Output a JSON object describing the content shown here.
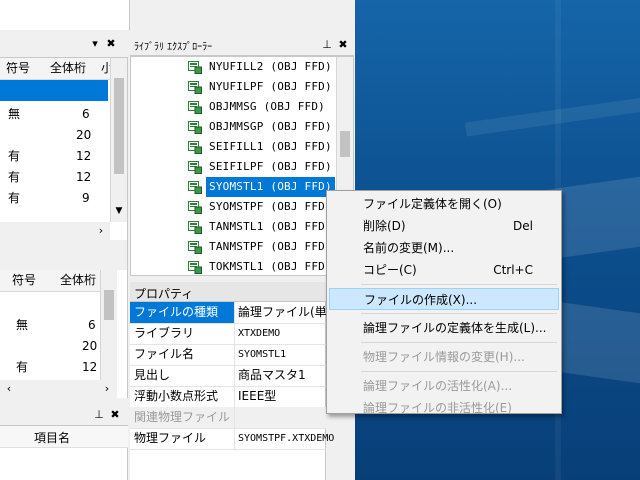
{
  "colors": {
    "selection": "#0078d7",
    "menu_highlight": "#cce8ff",
    "desktop": "#0c4f8e"
  },
  "left_grid_top": {
    "headers": [
      "符号",
      "全体桁",
      "小"
    ],
    "rows": [
      {
        "sign": "",
        "total": ""
      },
      {
        "sign": "無",
        "total": "6"
      },
      {
        "sign": "",
        "total": "20"
      },
      {
        "sign": "有",
        "total": "12"
      },
      {
        "sign": "有",
        "total": "12"
      },
      {
        "sign": "有",
        "total": "9"
      }
    ]
  },
  "left_grid_bottom": {
    "headers": [
      "符号",
      "全体桁"
    ],
    "rows": [
      {
        "sign": "無",
        "total": "6"
      },
      {
        "sign": "",
        "total": "20"
      },
      {
        "sign": "有",
        "total": "12"
      }
    ]
  },
  "left_bottom_panel": {
    "column_label": "項目名"
  },
  "explorer": {
    "title": "ﾗｲﾌﾞﾗﾘ ｴｸｽﾌﾟﾛｰﾗｰ",
    "items": [
      "NYUFILL2 (OBJ  FFD)",
      "NYUFILPF (OBJ  FFD)",
      "OBJMMSG  (OBJ  FFD)",
      "OBJMMSGP (OBJ  FFD)",
      "SEIFILL1 (OBJ  FFD)",
      "SEIFILPF (OBJ  FFD)",
      "SYOMSTL1 (OBJ  FFD)",
      "SYOMSTPF (OBJ  FFD)",
      "TANMSTL1 (OBJ  FFD)",
      "TANMSTPF (OBJ  FFD)",
      "TOKMSTL1 (OBJ  FFD)"
    ],
    "selected_index": 6
  },
  "properties": {
    "title": "プロパティ",
    "rows": [
      {
        "key": "ファイルの種類",
        "value": "論理ファイル(単純"
      },
      {
        "key": "ライブラリ",
        "value": "XTXDEMO"
      },
      {
        "key": "ファイル名",
        "value": "SYOMSTL1"
      },
      {
        "key": "見出し",
        "value": "商品マスタ1"
      },
      {
        "key": "浮動小数点形式",
        "value": "IEEE型"
      }
    ],
    "section": "関連物理ファイル",
    "physical": {
      "key": "物理ファイル",
      "value": "SYOMSTPF.XTXDEMO"
    }
  },
  "context_menu": {
    "items": [
      {
        "label": "ファイル定義体を開く(O)",
        "shortcut": "",
        "disabled": false
      },
      {
        "label": "削除(D)",
        "shortcut": "Del",
        "disabled": false
      },
      {
        "label": "名前の変更(M)...",
        "shortcut": "",
        "disabled": false
      },
      {
        "label": "コピー(C)",
        "shortcut": "Ctrl+C",
        "disabled": false
      },
      {
        "label": "ファイルの作成(X)...",
        "shortcut": "",
        "disabled": false
      },
      {
        "label": "論理ファイルの定義体を生成(L)...",
        "shortcut": "",
        "disabled": false
      },
      {
        "label": "物理ファイル情報の変更(H)...",
        "shortcut": "",
        "disabled": true
      },
      {
        "label": "論理ファイルの活性化(A)...",
        "shortcut": "",
        "disabled": true
      },
      {
        "label": "論理ファイルの非活性化(E)",
        "shortcut": "",
        "disabled": true
      }
    ],
    "highlighted_index": 4
  }
}
